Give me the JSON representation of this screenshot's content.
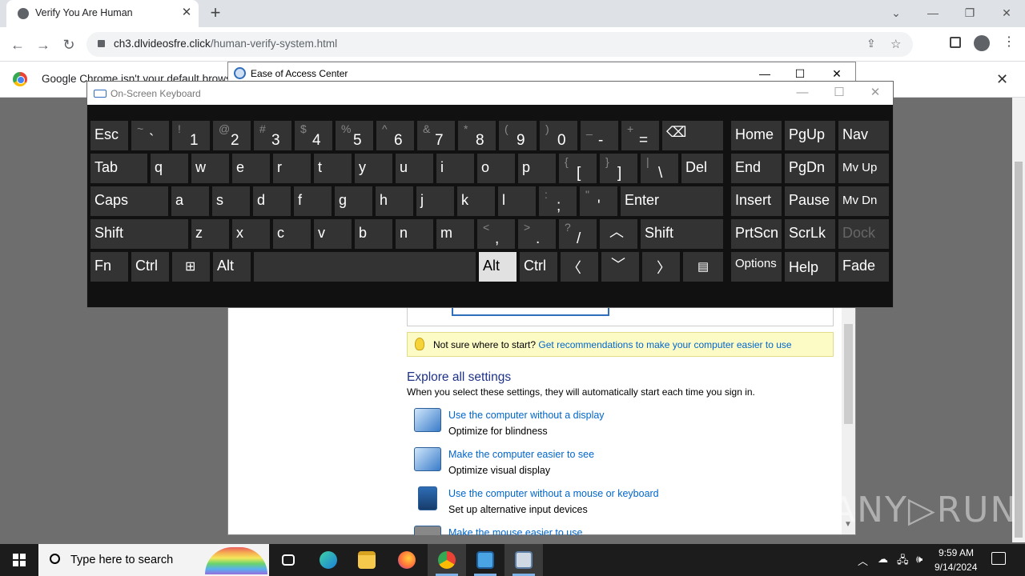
{
  "browser": {
    "tab_title": "Verify You Are Human",
    "url_host": "ch3.dlvideosfre.click",
    "url_path": "/human-verify-system.html",
    "infobar_text": "Google Chrome isn't your default brows",
    "new_tab": "+",
    "close": "✕"
  },
  "eoa": {
    "title": "Ease of Access Center",
    "tip_text": "Not sure where to start?",
    "tip_link": "Get recommendations to make your computer easier to use",
    "explore_title": "Explore all settings",
    "explore_sub": "When you select these settings, they will automatically start each time you sign in.",
    "settings": [
      {
        "link": "Use the computer without a display",
        "desc": "Optimize for blindness"
      },
      {
        "link": "Make the computer easier to see",
        "desc": "Optimize visual display"
      },
      {
        "link": "Use the computer without a mouse or keyboard",
        "desc": "Set up alternative input devices"
      },
      {
        "link": "Make the mouse easier to use",
        "desc": ""
      }
    ]
  },
  "osk": {
    "title": "On-Screen Keyboard",
    "active_key": "Alt",
    "rows": {
      "row1": {
        "esc": "Esc",
        "k1t": "~",
        "k1b": "`",
        "k2t": "!",
        "k2b": "1",
        "k3t": "@",
        "k3b": "2",
        "k4t": "#",
        "k4b": "3",
        "k5t": "$",
        "k5b": "4",
        "k6t": "%",
        "k6b": "5",
        "k7t": "^",
        "k7b": "6",
        "k8t": "&",
        "k8b": "7",
        "k9t": "*",
        "k9b": "8",
        "k10t": "(",
        "k10b": "9",
        "k11t": ")",
        "k11b": "0",
        "k12t": "_",
        "k12b": "-",
        "k13t": "+",
        "k13b": "=",
        "bksp": "⌫",
        "home": "Home",
        "pgup": "PgUp",
        "nav": "Nav"
      },
      "row2": {
        "tab": "Tab",
        "q": "q",
        "w": "w",
        "e": "e",
        "r": "r",
        "t": "t",
        "y": "y",
        "u": "u",
        "i": "i",
        "o": "o",
        "p": "p",
        "lbt": "{",
        "lbb": "[",
        "rbt": "}",
        "rbb": "]",
        "pit": "|",
        "pib": "\\",
        "del": "Del",
        "end": "End",
        "pgdn": "PgDn",
        "mvup": "Mv Up"
      },
      "row3": {
        "caps": "Caps",
        "a": "a",
        "s": "s",
        "d": "d",
        "f": "f",
        "g": "g",
        "h": "h",
        "j": "j",
        "k": "k",
        "l": "l",
        "sct": ":",
        "scb": ";",
        "qt": "\"",
        "qb": "'",
        "enter": "Enter",
        "insert": "Insert",
        "pause": "Pause",
        "mvdn": "Mv Dn"
      },
      "row4": {
        "shift": "Shift",
        "z": "z",
        "x": "x",
        "c": "c",
        "v": "v",
        "b": "b",
        "n": "n",
        "m": "m",
        "ct": "<",
        "cb": ",",
        "pt": ">",
        "pb": ".",
        "slt": "?",
        "slb": "/",
        "up": "︿",
        "shift2": "Shift",
        "prtscn": "PrtScn",
        "scrlk": "ScrLk",
        "dock": "Dock"
      },
      "row5": {
        "fn": "Fn",
        "ctrl": "Ctrl",
        "win": "⊞",
        "alt": "Alt",
        "alt2": "Alt",
        "ctrl2": "Ctrl",
        "left": "〈",
        "down": "﹀",
        "right": "〉",
        "menu": "▤",
        "options": "Options",
        "help": "Help",
        "fade": "Fade"
      }
    }
  },
  "taskbar": {
    "search_placeholder": "Type here to search",
    "time": "9:59 AM",
    "date": "9/14/2024"
  },
  "watermark": "ANY▷RUN"
}
